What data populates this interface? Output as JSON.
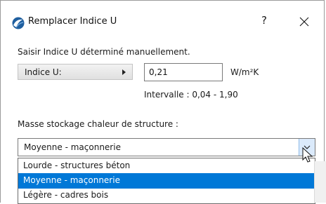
{
  "window": {
    "title": "Remplacer Indice U",
    "help_label": "?"
  },
  "form": {
    "instruction": "Saisir Indice U déterminé manuellement.",
    "indice_label": "Indice U:",
    "value": "0,21",
    "unit": "W/m²K",
    "range": "Intervalle : 0,04 - 1,90",
    "masse_label": "Masse stockage chaleur de structure :",
    "selected": "Moyenne - maçonnerie"
  },
  "dropdown": {
    "options": [
      {
        "label": "Lourde - structures béton"
      },
      {
        "label": "Moyenne - maçonnerie",
        "highlighted": true
      },
      {
        "label": "Légère - cadres bois"
      }
    ]
  },
  "colors": {
    "accent": "#0078d7",
    "arrow_button": "#dbeafb"
  }
}
